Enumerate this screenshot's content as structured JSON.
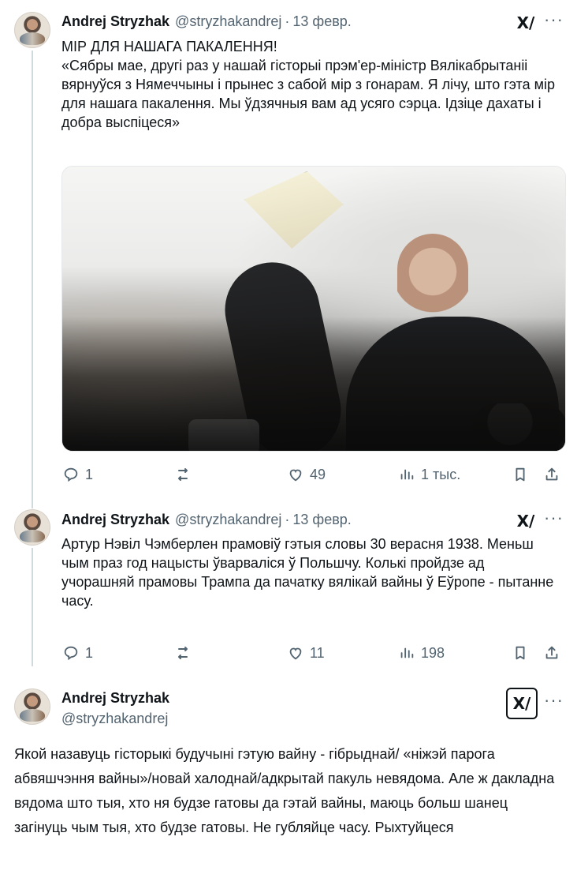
{
  "tweets": [
    {
      "author_name": "Andrej Stryzhak",
      "handle": "@stryzhakandrej",
      "separator": "·",
      "date": "13 февр.",
      "grok_label": "X/",
      "more_label": "···",
      "text": "МІР ДЛЯ НАШАГА ПАКАЛЕННЯ!\n«Сябры мае, другі раз у нашай гісторыі прэм'ер-міністр Вялікабрытаніі вярнуўся з Нямеччыны і прынес з сабой мір з гонарам. Я лічу, што гэта мір для нашага пакалення. Мы ўдзячныя вам ад усяго сэрца. Ідзіце дахаты і добра выспіцеся»",
      "actions": {
        "reply": "1",
        "repost": "",
        "like": "49",
        "views": "1 тыс."
      },
      "icons": {
        "reply": "reply-icon",
        "repost": "repost-icon",
        "like": "heart-icon",
        "views": "views-icon",
        "bookmark": "bookmark-icon",
        "share": "share-icon"
      }
    },
    {
      "author_name": "Andrej Stryzhak",
      "handle": "@stryzhakandrej",
      "separator": "·",
      "date": "13 февр.",
      "grok_label": "X/",
      "more_label": "···",
      "text": "Артур Нэвіл Чэмберлен прамовіў гэтыя словы 30 верасня 1938. Меньш чым праз год нацысты ўварваліся ў Польшчу. Колькі пройдзе ад учорашняй прамовы Трампа да пачатку вялікай вайны ў Еўропе - пытанне часу.",
      "actions": {
        "reply": "1",
        "repost": "",
        "like": "11",
        "views": "198"
      }
    },
    {
      "author_name": "Andrej Stryzhak",
      "handle": "@stryzhakandrej",
      "grok_label": "X/",
      "more_label": "···",
      "text": "Якой назавуць гісторыкі будучыні гэтую вайну - гібрыднай/ «ніжэй парога абвяшчэння вайны»/новай халоднай/адкрытай пакуль невядома. Але ж дакладна вядома што тыя, хто ня будзе гатовы да гэтай вайны, маюць больш шанец загінуць чым тыя, хто будзе гатовы. Не губляйце часу. Рыхтуйцеся"
    }
  ],
  "colors": {
    "text": "#0f1419",
    "muted": "#536471",
    "thread_line": "#cfd9de"
  }
}
